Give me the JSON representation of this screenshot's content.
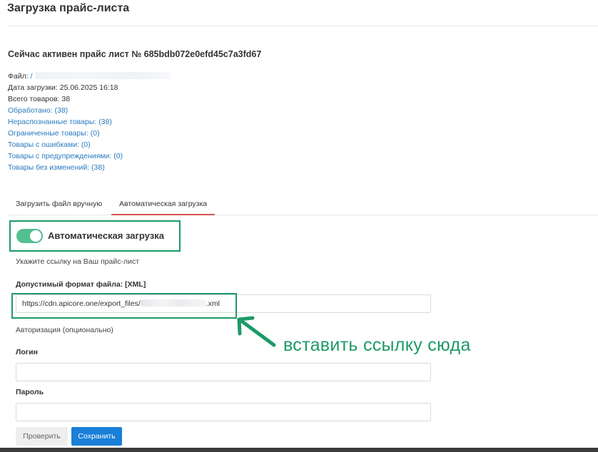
{
  "page": {
    "title": "Загрузка прайс-листа"
  },
  "active_pricelist": {
    "title": "Сейчас активен прайс лист № 685bdb072e0efd45c7a3fd67",
    "file_label": "Файл:",
    "file_value": "/",
    "upload_date": "Дата загрузки: 25.06.2025 16:18",
    "total": "Всего товаров: 38",
    "processed": "Обработано: (38)",
    "unrecognized": "Нераспознанные товары: (38)",
    "restricted": "Ограниченные товары: (0)",
    "errors": "Товары с ошибками: (0)",
    "warnings": "Товары с предупреждениями: (0)",
    "unchanged": "Товары без изменений: (38)"
  },
  "tabs": {
    "manual": "Загрузить файл вручную",
    "auto": "Автоматическая загрузка"
  },
  "auto_upload": {
    "toggle_label": "Автоматическая загрузка",
    "toggle_on": true,
    "hint": "Укажите ссылку на Ваш прайс-лист",
    "format_label": "Допустимый формат файла: [XML]",
    "url_start": "https://cdn.apicore.one/export_files/",
    "url_end": ".xml",
    "auth_label": "Авторизация (опционально)",
    "login_label": "Логин",
    "login_value": "",
    "password_label": "Пароль",
    "password_value": "",
    "check_button": "Проверить",
    "save_button": "Сохранить"
  },
  "annotation": {
    "text": "вставить ссылку сюда",
    "color": "#1d9a67"
  },
  "colors": {
    "link": "#2a7ac0",
    "toggle": "#52c08f",
    "tab_active_underline": "#d9534f",
    "primary_button": "#1a7fd8"
  }
}
